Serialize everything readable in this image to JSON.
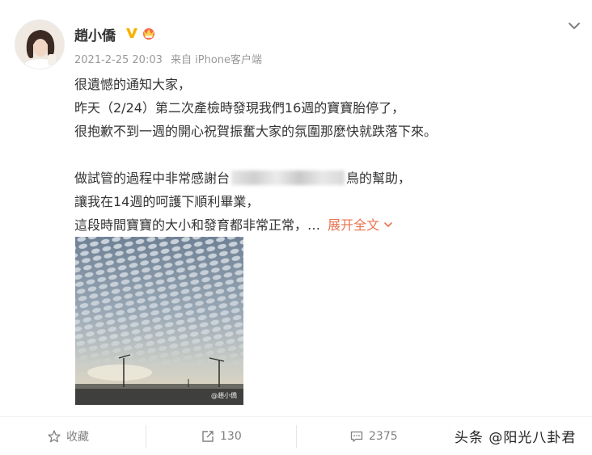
{
  "post": {
    "author": "趙小僑",
    "timestamp": "2021-2-25 20:03",
    "source": "来自 iPhone客户端",
    "lines": [
      "很遺憾的通知大家，",
      "昨天（2/24）第二次產檢時發現我們16週的寶寶胎停了，",
      "很抱歉不到一週的開心祝賀振奮大家的氛圍那麼快就跌落下來。"
    ],
    "line4_prefix": "做試管的過程中非常感謝台",
    "line4_suffix": "鳥的幫助，",
    "line5": "讓我在14週的呵護下順利畢業，",
    "line6": "這段時間寶寶的大小和發育都非常正常，…",
    "expand_label": "展开全文"
  },
  "image": {
    "watermark": "@趙小僑"
  },
  "actions": {
    "favorite_label": "收藏",
    "repost_count": "130",
    "comment_count": "2375"
  },
  "overlay": {
    "toutiao_watermark": "头条 @阳光八卦君"
  },
  "icons": {
    "verified": "verified-v-icon",
    "vip": "vip-crown-icon",
    "menu": "chevron-down-icon",
    "favorite": "star-icon",
    "repost": "repost-icon",
    "comment": "comment-icon"
  },
  "colors": {
    "accent": "#eb7350",
    "verified": "#f7b300",
    "muted": "#999999"
  }
}
